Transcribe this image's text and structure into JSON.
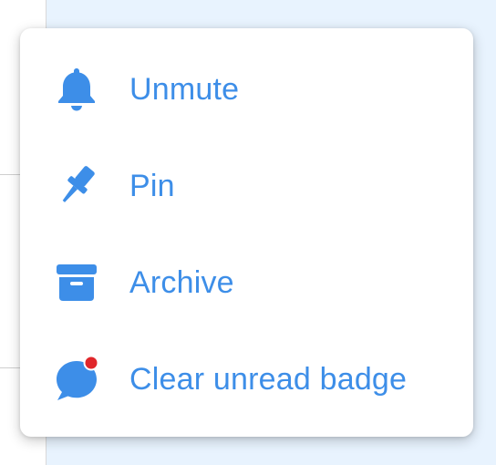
{
  "menu": {
    "accent_color": "#3d8ee8",
    "badge_color": "#e0262a",
    "items": [
      {
        "label": "Unmute",
        "icon": "bell-icon"
      },
      {
        "label": "Pin",
        "icon": "pin-icon"
      },
      {
        "label": "Archive",
        "icon": "archive-icon"
      },
      {
        "label": "Clear unread badge",
        "icon": "chat-badge-icon"
      }
    ]
  }
}
